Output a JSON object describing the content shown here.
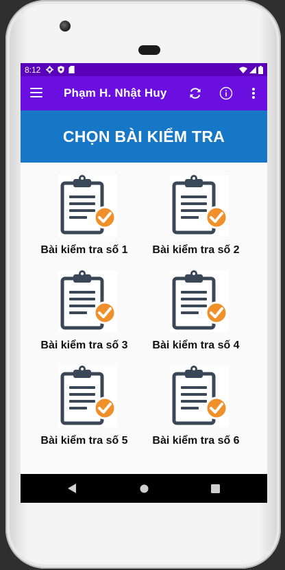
{
  "status": {
    "time": "8:12"
  },
  "appbar": {
    "title": "Phạm H. Nhật Huy"
  },
  "banner": {
    "title": "CHỌN BÀI KIỂM TRA"
  },
  "tests": [
    {
      "label": "Bài kiểm tra số 1"
    },
    {
      "label": "Bài kiểm tra số 2"
    },
    {
      "label": "Bài kiểm tra số 3"
    },
    {
      "label": "Bài kiểm tra số 4"
    },
    {
      "label": "Bài kiểm tra số 5"
    },
    {
      "label": "Bài kiểm tra số 6"
    }
  ],
  "icons": {
    "menu": "menu-icon",
    "refresh": "refresh-icon",
    "info": "info-icon",
    "more": "more-vert-icon",
    "test": "clipboard-check-icon",
    "back": "back-icon",
    "home": "home-icon",
    "recents": "recents-icon"
  },
  "colors": {
    "status_bar": "#5a00b8",
    "app_bar": "#6a0fe0",
    "banner": "#1777c7",
    "check": "#f0902a",
    "clipboard": "#3a4756"
  }
}
